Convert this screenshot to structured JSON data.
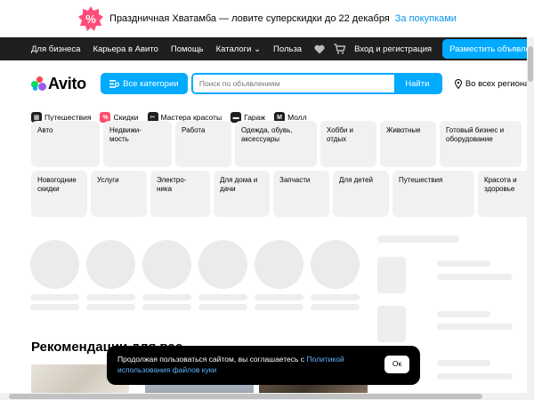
{
  "promo": {
    "badge_icon": "percent-badge-icon",
    "badge_text": "%",
    "text": "Праздничная Хватамба — ловите суперскидки до 22 декабря",
    "link": "За покупками"
  },
  "topbar": {
    "nav": [
      "Для бизнеса",
      "Карьера в Авито",
      "Помощь",
      "Каталоги",
      "Польза"
    ],
    "catalog_chevron": "⌄",
    "login": "Вход и регистрация",
    "post_button": "Разместить объявление"
  },
  "header": {
    "logo_text": "Avito",
    "categories_button": "Все категории",
    "search_placeholder": "Поиск по объявлениям",
    "search_button": "Найти",
    "region": "Во всех регионах"
  },
  "quick_links": [
    {
      "label": "Путешествия",
      "icon": "travel-icon",
      "color": "#1f1f1f",
      "glyph": "▦"
    },
    {
      "label": "Скидки",
      "icon": "discount-icon",
      "color": "#ff4d6d",
      "glyph": "%"
    },
    {
      "label": "Мастера красоты",
      "icon": "beauty-icon",
      "color": "#1f1f1f",
      "glyph": "✂"
    },
    {
      "label": "Гараж",
      "icon": "garage-icon",
      "color": "#1f1f1f",
      "glyph": "▬"
    },
    {
      "label": "Молл",
      "icon": "mall-icon",
      "color": "#1f1f1f",
      "glyph": "M"
    }
  ],
  "categories_row1": [
    "Авто",
    "Недвижи-\nмость",
    "Работа",
    "Одежда, обувь, аксессуары",
    "Хобби и отдых",
    "Животные",
    "Готовый бизнес и оборудование"
  ],
  "categories_row2": [
    "Новогодние скидки",
    "Услуги",
    "Электро-\nника",
    "Для дома и дачи",
    "Запчасти",
    "Для детей",
    "Путешествия",
    "Красота и здоровье"
  ],
  "recommendations_title": "Рекомендации для вас",
  "cookie": {
    "text": "Продолжая пользоваться сайтом, вы соглашаетесь с ",
    "link": "Политикой использования файлов куки",
    "ok": "Ок"
  },
  "colors": {
    "accent": "#00aaff",
    "topbar": "#1f1f1f",
    "category_bg": "#f2f1f0"
  }
}
